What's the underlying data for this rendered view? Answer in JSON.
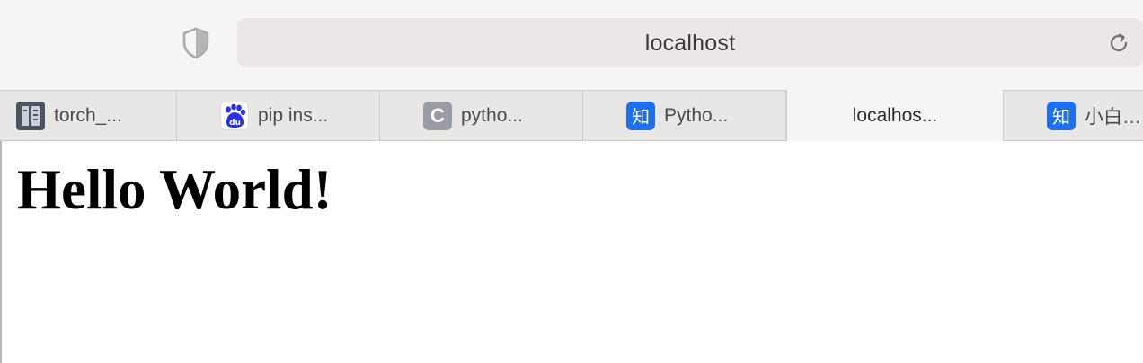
{
  "toolbar": {
    "url": "localhost",
    "shield_icon": "privacy-shield-icon",
    "reload_icon": "reload-icon"
  },
  "tabs": [
    {
      "label": "torch_...",
      "icon": "document-icon"
    },
    {
      "label": "pip ins...",
      "icon": "baidu-paw-icon",
      "icon_text": "du"
    },
    {
      "label": "pytho...",
      "icon": "letter-c-icon",
      "icon_text": "C"
    },
    {
      "label": "Pytho...",
      "icon": "zhihu-icon",
      "icon_text": "知"
    },
    {
      "label": "localhos...",
      "active": true
    },
    {
      "label": "小白…",
      "icon": "zhihu-icon",
      "icon_text": "知"
    }
  ],
  "page": {
    "heading": "Hello World!"
  },
  "colors": {
    "toolbar_bg": "#f7f4f4",
    "address_bg": "#ebe7e7",
    "tabbar_bg": "#e9e6e6",
    "zhihu_blue": "#1e6ff0",
    "c_icon_gray": "#9a9ba3"
  }
}
